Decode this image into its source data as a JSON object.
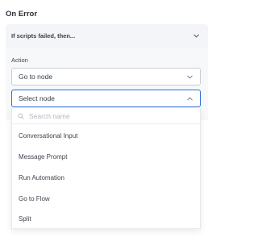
{
  "section": {
    "title": "On Error"
  },
  "condition": {
    "label": "If scripts failed, then..."
  },
  "action": {
    "label": "Action",
    "selected_value": "Go to node"
  },
  "node_select": {
    "placeholder_value": "Select node",
    "search_placeholder": "Search name",
    "options": [
      "Conversational Input",
      "Message Prompt",
      "Run Automation",
      "Go to Flow",
      "Split"
    ]
  },
  "colors": {
    "focus_border": "#2f6fd8",
    "panel_bg": "#f7f8fa"
  }
}
